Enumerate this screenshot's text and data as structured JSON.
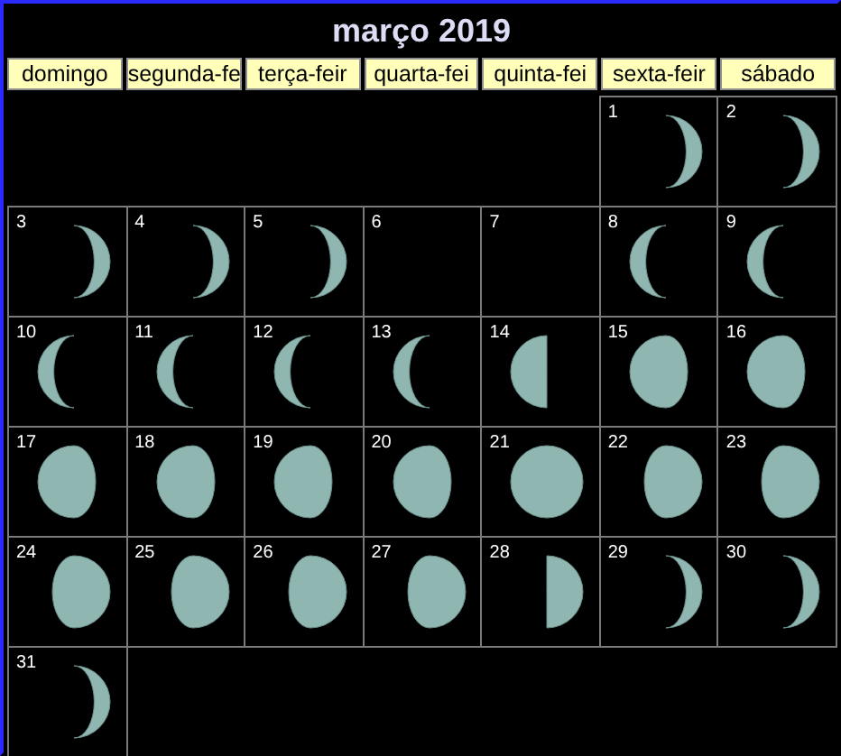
{
  "title": "março 2019",
  "weekdays": [
    "domingo",
    "segunda-fe",
    "terça-feir",
    "quarta-fei",
    "quinta-fei",
    "sexta-feir",
    "sábado"
  ],
  "weeks": [
    [
      {
        "kind": "blank"
      },
      {
        "kind": "blank"
      },
      {
        "kind": "blank"
      },
      {
        "kind": "blank"
      },
      {
        "kind": "blank"
      },
      {
        "kind": "waning-crescent",
        "day": "1"
      },
      {
        "kind": "waning-crescent",
        "day": "2"
      }
    ],
    [
      {
        "kind": "waning-crescent",
        "day": "3"
      },
      {
        "kind": "waning-crescent",
        "day": "4"
      },
      {
        "kind": "waning-crescent",
        "day": "5"
      },
      {
        "kind": "new",
        "day": "6"
      },
      {
        "kind": "new",
        "day": "7"
      },
      {
        "kind": "waxing-crescent",
        "day": "8"
      },
      {
        "kind": "waxing-crescent",
        "day": "9"
      }
    ],
    [
      {
        "kind": "waxing-crescent",
        "day": "10"
      },
      {
        "kind": "waxing-crescent",
        "day": "11"
      },
      {
        "kind": "waxing-crescent",
        "day": "12"
      },
      {
        "kind": "waxing-crescent",
        "day": "13"
      },
      {
        "kind": "first-quarter",
        "day": "14"
      },
      {
        "kind": "waxing-gibbous",
        "day": "15"
      },
      {
        "kind": "waxing-gibbous",
        "day": "16"
      }
    ],
    [
      {
        "kind": "waxing-gibbous",
        "day": "17"
      },
      {
        "kind": "waxing-gibbous",
        "day": "18"
      },
      {
        "kind": "waxing-gibbous",
        "day": "19"
      },
      {
        "kind": "waxing-gibbous",
        "day": "20"
      },
      {
        "kind": "full",
        "day": "21"
      },
      {
        "kind": "waning-gibbous",
        "day": "22"
      },
      {
        "kind": "waning-gibbous",
        "day": "23"
      }
    ],
    [
      {
        "kind": "waning-gibbous",
        "day": "24"
      },
      {
        "kind": "waning-gibbous",
        "day": "25"
      },
      {
        "kind": "waning-gibbous",
        "day": "26"
      },
      {
        "kind": "waning-gibbous",
        "day": "27"
      },
      {
        "kind": "last-quarter",
        "day": "28"
      },
      {
        "kind": "waning-crescent",
        "day": "29"
      },
      {
        "kind": "waning-crescent",
        "day": "30"
      }
    ],
    [
      {
        "kind": "waning-crescent",
        "day": "31"
      },
      {
        "kind": "blank"
      },
      {
        "kind": "blank"
      },
      {
        "kind": "blank"
      },
      {
        "kind": "blank"
      },
      {
        "kind": "blank"
      },
      {
        "kind": "blank"
      }
    ]
  ]
}
